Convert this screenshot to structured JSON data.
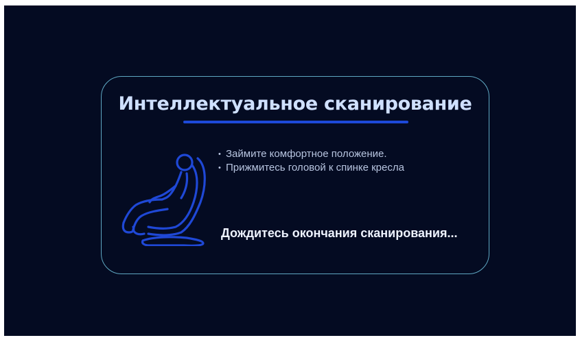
{
  "scan_card": {
    "title": "Интеллектуальное сканирование",
    "instructions": [
      "Займите комфортное положение.",
      "Прижмитесь головой к спинке кресла"
    ],
    "status_text": "Дождитесь окончания сканирования...",
    "icon": "massage-chair-icon"
  },
  "colors": {
    "background": "#040b22",
    "card_border": "#5fa8c3",
    "title": "#cfe0ff",
    "accent": "#1d49d8",
    "text": "#b8c5e0"
  }
}
